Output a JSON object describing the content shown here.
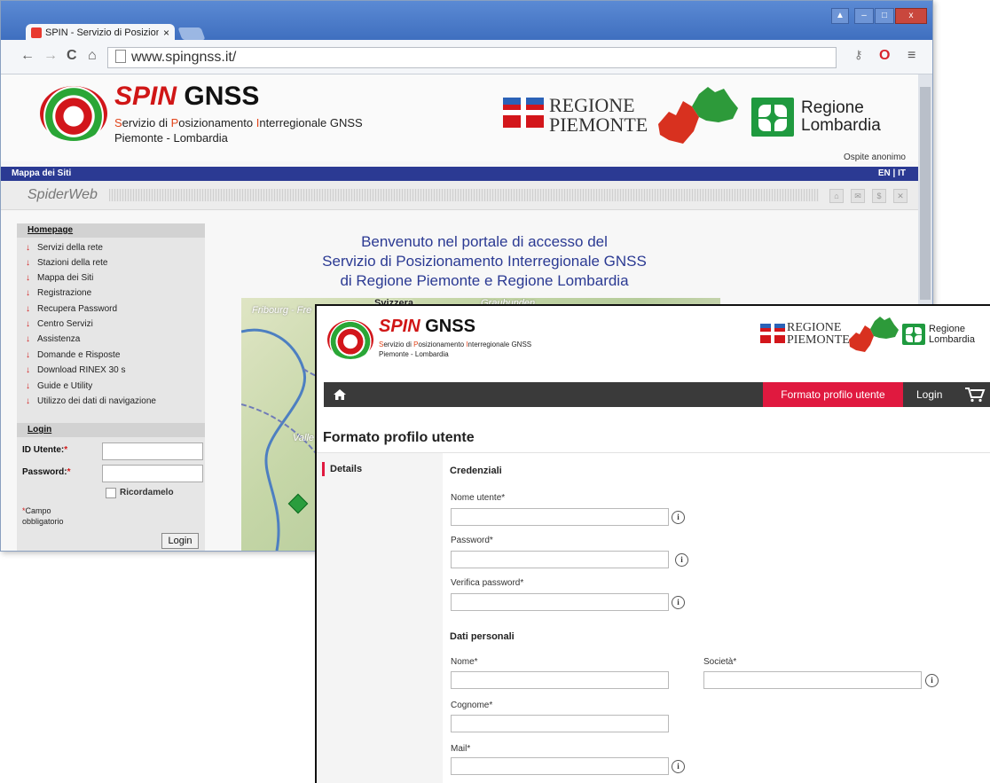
{
  "browser": {
    "tab_title": "SPIN - Servizio di Posizioname",
    "tab_close": "×",
    "url": "www.spingnss.it/",
    "win_controls": [
      "▲",
      "–",
      "□",
      "x"
    ],
    "nav_back": "←",
    "nav_forward": "→",
    "nav_reload": "C",
    "nav_home": "⌂",
    "key_icon": "🔑",
    "opera_icon": "O",
    "menu_icon": "≡"
  },
  "site": {
    "brand_spin": "SPIN",
    "brand_gnss": "GNSS",
    "sub_s": "S",
    "sub_1": "ervizio di ",
    "sub_p": "P",
    "sub_2": "osizionamento ",
    "sub_i": "I",
    "sub_3": "nterregionale GNSS",
    "sub_line2": "Piemonte - Lombardia",
    "regione_piemonte_1": "REGIONE",
    "regione_piemonte_2": "PIEMONTE",
    "regione_lombardia_1": "Regione",
    "regione_lombardia_2": "Lombardia",
    "ospite": "Ospite anonimo",
    "mappa_dei_siti": "Mappa dei Siti",
    "lang": "EN | IT",
    "spiderweb": "SpiderWeb",
    "spider_icons": [
      "⌂",
      "✉",
      "$",
      "✕"
    ]
  },
  "sidebar": {
    "homepage": "Homepage",
    "items": [
      "Servizi della rete",
      "Stazioni della rete",
      "Mappa dei Siti",
      "Registrazione",
      "Recupera Password",
      "Centro Servizi",
      "Assistenza",
      "Domande e Risposte",
      "Download RINEX 30 s",
      "Guide e Utility",
      "Utilizzo dei dati di navigazione"
    ],
    "arrow": "↓",
    "login_head": "Login",
    "id_label": "ID Utente:",
    "password_label": "Password:",
    "required_mark": "*",
    "ricordamelo": "Ricordamelo",
    "campo_1": "Campo",
    "campo_2": "obbligatorio",
    "login_button": "Login"
  },
  "welcome": {
    "line1": "Benvenuto nel portale di accesso del",
    "line2": "Servizio di Posizionamento Interregionale GNSS",
    "line3": "di Regione Piemonte e Regione Lombardia"
  },
  "map": {
    "label1": "Fribourg - Fre",
    "label2": "Graubunden",
    "label3": "Valle",
    "label4": "Svizzera"
  },
  "card": {
    "nav_formato": "Formato profilo utente",
    "nav_login": "Login",
    "page_title": "Formato profilo utente",
    "details_tab": "Details",
    "sec_credenziali": "Credenziali",
    "nome_utente": "Nome utente*",
    "password": "Password*",
    "verifica_password": "Verifica password*",
    "sec_dati": "Dati personali",
    "nome": "Nome*",
    "societa": "Società*",
    "cognome": "Cognome*",
    "mail": "Mail*",
    "info_glyph": "i"
  },
  "colors": {
    "accent_red": "#e0193f",
    "nav_dark": "#3a3a3a",
    "site_blue": "#2b3a93"
  }
}
